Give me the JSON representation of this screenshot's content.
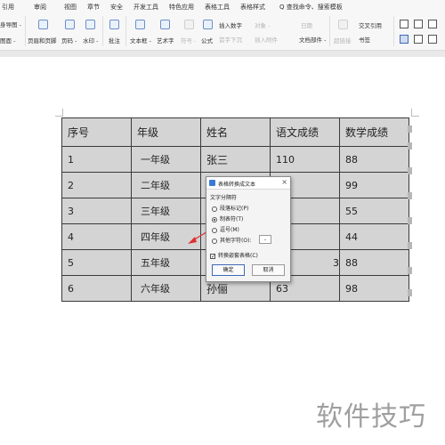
{
  "menu": {
    "items": [
      "引用",
      "审阅",
      "视图",
      "章节",
      "安全",
      "开发工具",
      "特色应用",
      "表格工具",
      "表格样式"
    ],
    "search": "Q 查找命令、搜索模板"
  },
  "ribbon": {
    "left_top": "身导图 -",
    "left_bottom": "图面 -",
    "header_footer": "页眉和页脚",
    "page_number": "页码 -",
    "watermark": "水印 -",
    "comment": "批注",
    "textbox": "文本框 -",
    "wordart": "艺术字",
    "symbol": "符号 -",
    "formula": "公式",
    "insert_number": "插入数字",
    "object": "对象 -",
    "date": "日期",
    "first_drop_cap": "首字下沉",
    "insert_attachment": "插入附件",
    "doc_parts": "文档部件 -",
    "hyperlink": "超链接",
    "cross_ref": "交叉引用",
    "bookmark": "书签"
  },
  "table": {
    "headers": [
      "序号",
      "年级",
      "姓名",
      "语文成绩",
      "数学成绩"
    ],
    "rows": [
      [
        "1",
        "一年级",
        "张三",
        "110",
        "88"
      ],
      [
        "2",
        "二年级",
        "",
        "",
        "99"
      ],
      [
        "3",
        "三年级",
        "",
        "",
        "55"
      ],
      [
        "4",
        "四年级",
        "",
        "",
        "44"
      ],
      [
        "5",
        "五年级",
        "",
        "3",
        "88"
      ],
      [
        "6",
        "六年级",
        "孙俪",
        "63",
        "98"
      ]
    ]
  },
  "dialog": {
    "title": "表格转换成文本",
    "close": "×",
    "group_label": "文字分隔符",
    "options": [
      "段落标记(P)",
      "制表符(T)",
      "逗号(M)",
      "其他字符(O):"
    ],
    "selected_option": "制表符(T)",
    "other_char": "-",
    "checkbox_label": "转换嵌套表格(C)",
    "checkbox_checked": true,
    "ok": "确定",
    "cancel": "取消"
  },
  "watermark_text": "软件技巧",
  "colors": {
    "table_fill": "#d4d4d4",
    "arrow": "#e03030",
    "accent": "#3e6ab6"
  }
}
